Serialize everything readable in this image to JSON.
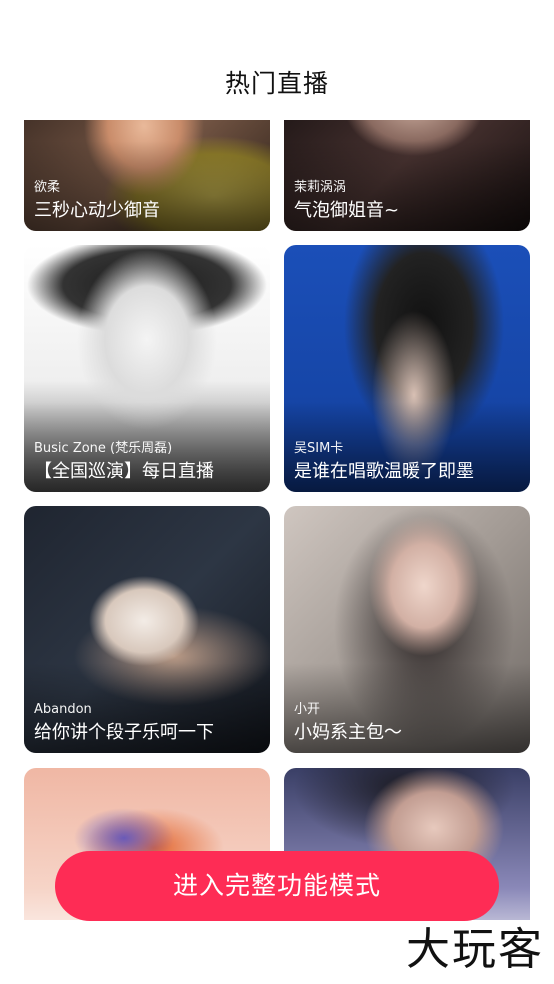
{
  "header": {
    "title": "热门直播"
  },
  "streams": [
    {
      "host": "欲柔",
      "room": "三秒心动少御音"
    },
    {
      "host": "茉莉涡涡",
      "room": "气泡御姐音~"
    },
    {
      "host": "Busic Zone (梵乐周磊)",
      "room": "【全国巡演】每日直播"
    },
    {
      "host": "吴SIM卡",
      "room": "是谁在唱歌温暖了即墨"
    },
    {
      "host": "Abandon",
      "room": "给你讲个段子乐呵一下"
    },
    {
      "host": "小开",
      "room": "小妈系主包～"
    },
    {
      "host": "",
      "room": ""
    },
    {
      "host": "",
      "room": ""
    }
  ],
  "cta": {
    "label": "进入完整功能模式"
  },
  "watermark": {
    "text": "大玩客"
  },
  "colors": {
    "accent": "#fe2c55",
    "background": "#ffffff"
  }
}
